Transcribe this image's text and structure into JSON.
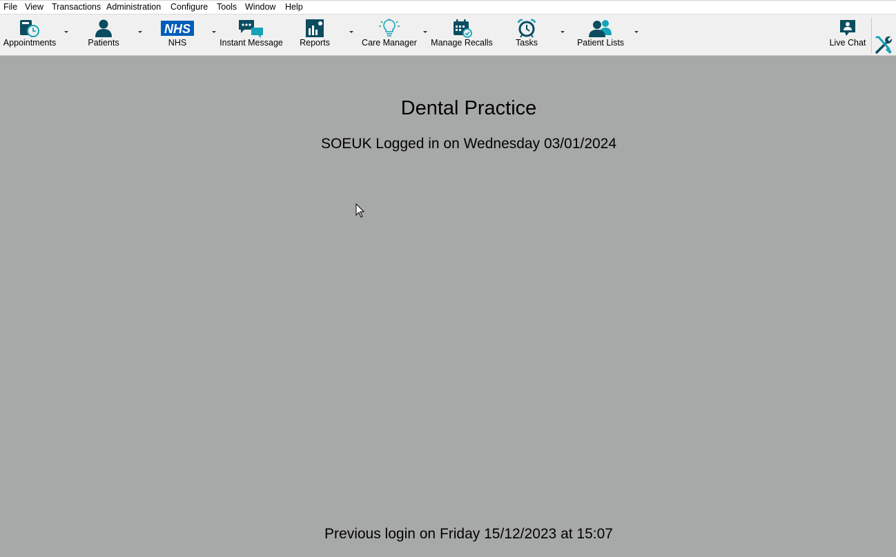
{
  "menu": {
    "items": [
      {
        "label": "File"
      },
      {
        "label": "View"
      },
      {
        "label": "Transactions"
      },
      {
        "label": "Administration"
      },
      {
        "label": "Configure"
      },
      {
        "label": "Tools"
      },
      {
        "label": "Window"
      },
      {
        "label": "Help"
      }
    ]
  },
  "toolbar": {
    "appointments": {
      "label": "Appointments",
      "icon": "appointments-book-clock-icon"
    },
    "patients": {
      "label": "Patients",
      "icon": "patient-person-icon"
    },
    "nhs": {
      "label": "NHS",
      "icon": "nhs-logo-icon",
      "logo_text": "NHS"
    },
    "instant_message": {
      "label": "Instant Message",
      "icon": "chat-bubbles-icon"
    },
    "reports": {
      "label": "Reports",
      "icon": "bar-chart-icon"
    },
    "care_manager": {
      "label": "Care Manager",
      "icon": "lightbulb-icon"
    },
    "manage_recalls": {
      "label": "Manage Recalls",
      "icon": "calendar-check-icon"
    },
    "tasks": {
      "label": "Tasks",
      "icon": "alarm-clock-icon"
    },
    "patient_lists": {
      "label": "Patient Lists",
      "icon": "people-group-icon"
    },
    "live_chat": {
      "label": "Live Chat",
      "icon": "live-chat-icon"
    },
    "tools": {
      "icon": "wrench-screwdriver-icon"
    }
  },
  "main": {
    "practice_name": "Dental Practice",
    "login_line": "SOEUK Logged in on Wednesday 03/01/2024",
    "previous_login": "Previous login on Friday 15/12/2023 at 15:07"
  },
  "colors": {
    "icon_primary": "#0b4c5f",
    "icon_accent": "#17a2b8",
    "nhs_blue": "#005eb8",
    "background": "#a7a9a8",
    "toolbar_bg": "#f0f0f0"
  }
}
